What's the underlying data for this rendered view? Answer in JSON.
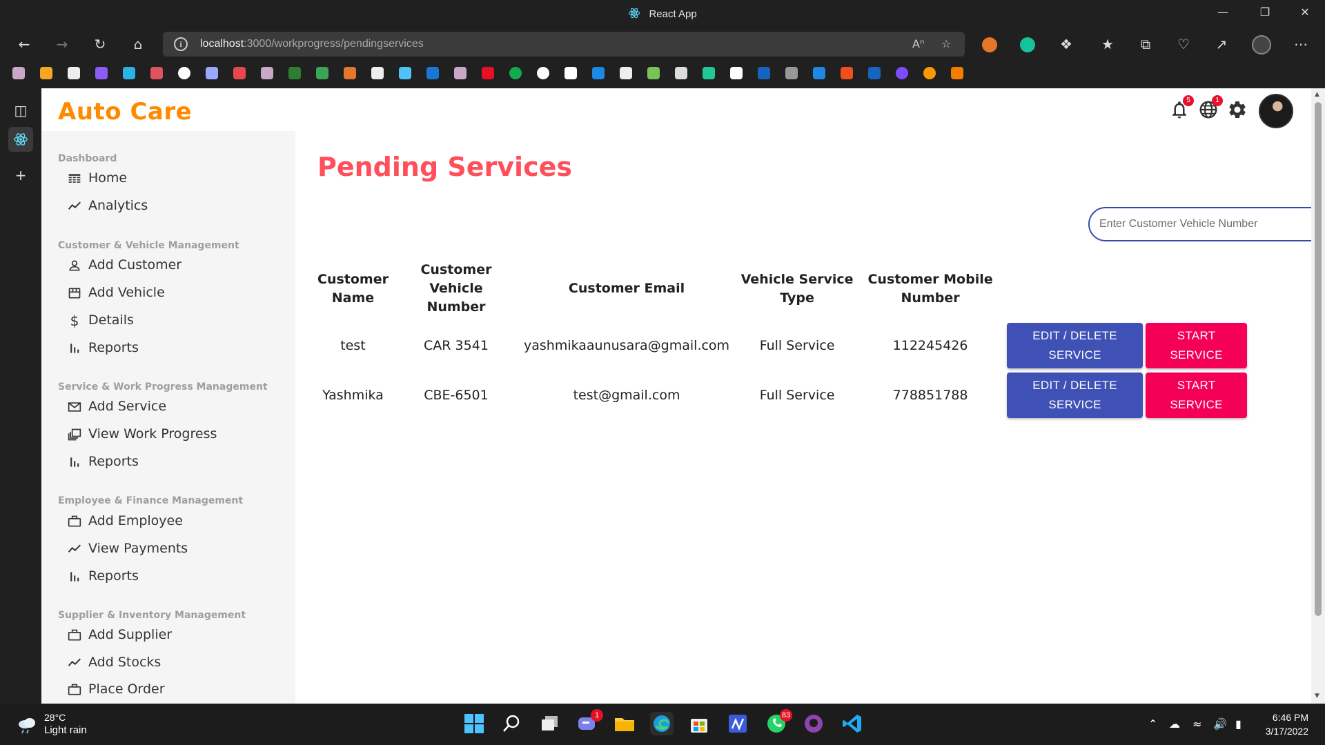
{
  "window": {
    "title": "React App"
  },
  "browser": {
    "url_host": "localhost",
    "url_path": ":3000/workprogress/pendingservices"
  },
  "app": {
    "brand": "Auto Care",
    "notifications_count": "5",
    "language_count": "1"
  },
  "sidebar": {
    "sections": [
      {
        "title": "Dashboard",
        "items": [
          {
            "label": "Home",
            "icon": "dashboard-icon"
          },
          {
            "label": "Analytics",
            "icon": "trending-icon"
          }
        ]
      },
      {
        "title": "Customer & Vehicle Management",
        "items": [
          {
            "label": "Add Customer",
            "icon": "person-icon"
          },
          {
            "label": "Add Vehicle",
            "icon": "storefront-icon"
          },
          {
            "label": "Details",
            "icon": "dollar-icon"
          },
          {
            "label": "Reports",
            "icon": "bar-chart-icon"
          }
        ]
      },
      {
        "title": "Service & Work Progress Management",
        "items": [
          {
            "label": "Add Service",
            "icon": "mail-icon"
          },
          {
            "label": "View Work Progress",
            "icon": "library-icon"
          },
          {
            "label": "Reports",
            "icon": "bar-chart-icon"
          }
        ]
      },
      {
        "title": "Employee & Finance Management",
        "items": [
          {
            "label": "Add Employee",
            "icon": "briefcase-icon"
          },
          {
            "label": "View Payments",
            "icon": "trending-icon"
          },
          {
            "label": "Reports",
            "icon": "bar-chart-icon"
          }
        ]
      },
      {
        "title": "Supplier & Inventory Management",
        "items": [
          {
            "label": "Add Supplier",
            "icon": "briefcase-icon"
          },
          {
            "label": "Add Stocks",
            "icon": "trending-icon"
          },
          {
            "label": "Place Order",
            "icon": "briefcase-icon"
          }
        ]
      }
    ]
  },
  "main": {
    "title": "Pending Services",
    "search_placeholder": "Enter Customer Vehicle Number",
    "columns": [
      "Customer Name",
      "Customer Vehicle Number",
      "Customer Email",
      "Vehicle Service Type",
      "Customer Mobile Number"
    ],
    "column_lines": [
      [
        "Customer",
        "Name"
      ],
      [
        "Customer Vehicle",
        "Number"
      ],
      [
        "Customer Email"
      ],
      [
        "Vehicle Service",
        "Type"
      ],
      [
        "Customer Mobile",
        "Number"
      ]
    ],
    "rows": [
      {
        "name": "test",
        "vehicle": "CAR 3541",
        "email": "yashmikaaunusara@gmail.com",
        "type": "Full Service",
        "mobile": "112245426"
      },
      {
        "name": "Yashmika",
        "vehicle": "CBE-6501",
        "email": "test@gmail.com",
        "type": "Full Service",
        "mobile": "778851788"
      }
    ],
    "edit_label_1": "EDIT / DELETE",
    "edit_label_2": "SERVICE",
    "start_label_1": "START",
    "start_label_2": "SERVICE"
  },
  "taskbar": {
    "temperature": "28°C",
    "condition": "Light rain",
    "teams_badge": "1",
    "whatsapp_badge": "83",
    "time": "6:46 PM",
    "date": "3/17/2022"
  },
  "colors": {
    "brand": "#ff8a00",
    "title": "#ff4f5a",
    "edit_button": "#3f51b5",
    "start_button": "#f50057"
  }
}
